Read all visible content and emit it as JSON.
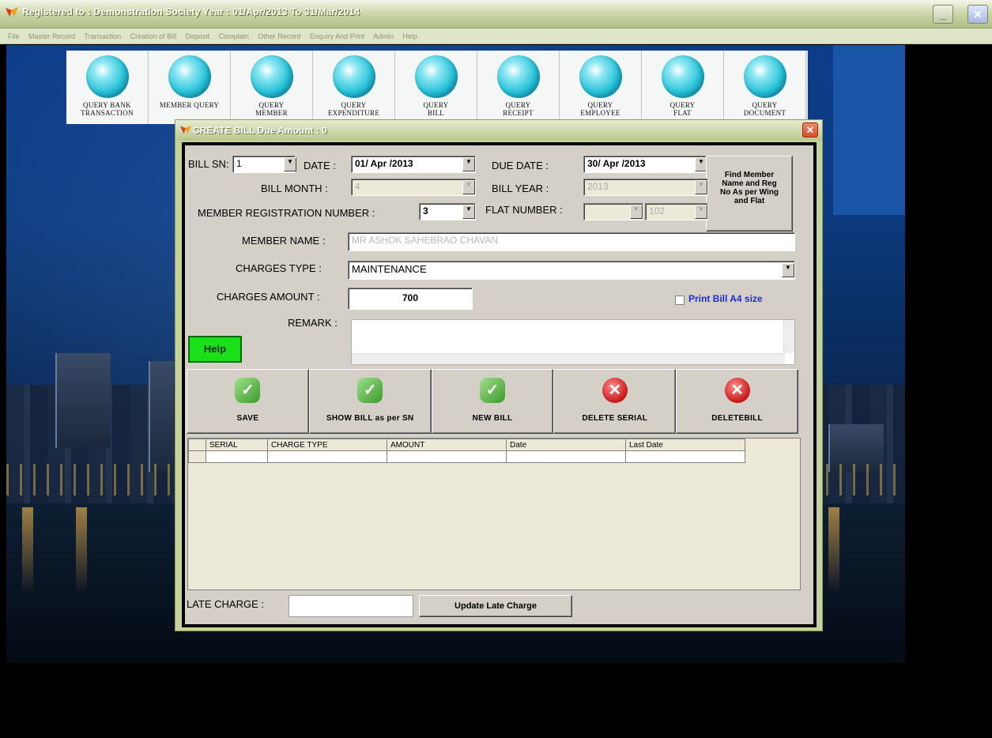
{
  "window": {
    "title": "Registered to : Demonstration Society    Year :  01/Apr/2013  To  31/Mar/2014",
    "minimize": "_",
    "close": "✕"
  },
  "menu": [
    "File",
    "Master Record",
    "Transaction",
    "Creation of Bill",
    "Deposit",
    "Complain",
    "Other Record",
    "Enquiry And Print",
    "Admin",
    "Help"
  ],
  "toolbar": [
    {
      "label": "QUERY  BANK\nTRANSACTION"
    },
    {
      "label": "MEMBER QUERY"
    },
    {
      "label": "QUERY\nMEMBER"
    },
    {
      "label": "QUERY\nEXPENDITURE"
    },
    {
      "label": "QUERY\nBILL"
    },
    {
      "label": "QUERY\nRECEIPT"
    },
    {
      "label": "QUERY\nEMPLOYEE"
    },
    {
      "label": "QUERY\nFLAT"
    },
    {
      "label": "QUERY\nDOCUMENT"
    }
  ],
  "dialog": {
    "title": "CREATE BILL    Due Amount :  0",
    "close": "✕",
    "bill_sn_label": "BILL SN:",
    "bill_sn_value": "1",
    "date_label": "DATE :",
    "date_value": "01/ Apr /2013",
    "due_date_label": "DUE DATE :",
    "due_date_value": "30/ Apr /2013",
    "find_member": "Find Member\nName and Reg\nNo As per Wing\nand Flat",
    "bill_month_label": "BILL MONTH :",
    "bill_month_value": "4",
    "bill_year_label": "BILL YEAR :",
    "bill_year_value": "2013",
    "member_reg_label": "MEMBER REGISTRATION NUMBER :",
    "member_reg_value": "3",
    "flat_number_label": "FLAT NUMBER :",
    "flat_wing_value": "",
    "flat_no_value": "102",
    "member_name_label": "MEMBER NAME :",
    "member_name_value": "MR ASHOK SAHEBRAO CHAVAN",
    "charges_type_label": "CHARGES TYPE :",
    "charges_type_value": "MAINTENANCE",
    "charges_amount_label": "CHARGES AMOUNT :",
    "charges_amount_value": "700",
    "print_a4_label": "Print Bill A4 size",
    "remark_label": "REMARK :",
    "help_label": "Help",
    "actions": [
      {
        "label": "SAVE",
        "icon": "check-icon"
      },
      {
        "label": "SHOW BILL as per SN",
        "icon": "check-icon"
      },
      {
        "label": "NEW BILL",
        "icon": "check-icon"
      },
      {
        "label": "DELETE SERIAL",
        "icon": "x-circle-icon"
      },
      {
        "label": "DELETEBILL",
        "icon": "x-circle-icon"
      }
    ],
    "grid_columns": [
      "SERIAL",
      "CHARGE TYPE",
      "AMOUNT",
      "Date",
      "Last Date"
    ],
    "late_charge_label": "LATE CHARGE :",
    "late_charge_value": "",
    "update_late_charge": "Update Late Charge"
  },
  "colors": {
    "dialog_frame": "#c7d29a",
    "panel": "#d4d0c8",
    "help_button": "#19e019",
    "print_label": "#1a2bd8"
  }
}
